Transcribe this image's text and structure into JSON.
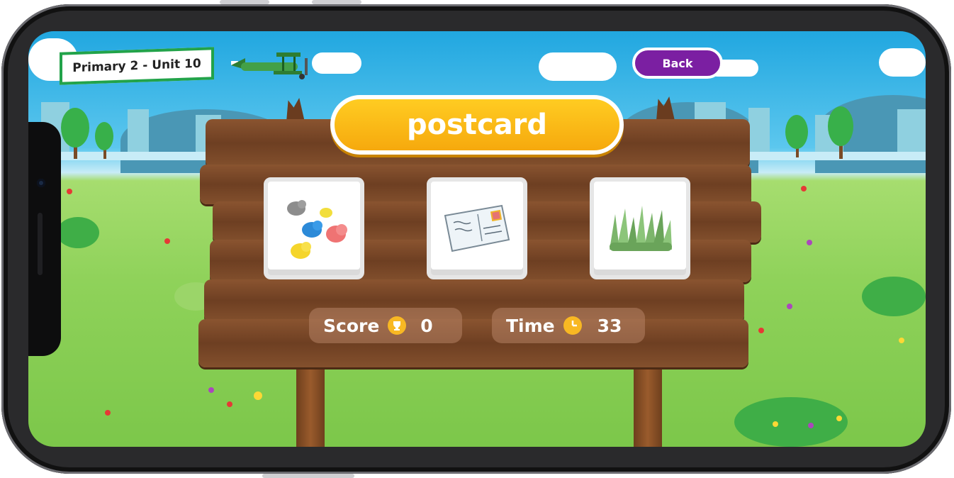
{
  "header": {
    "level_label": "Primary 2 - Unit 10",
    "back_label": "Back"
  },
  "game": {
    "target_word": "postcard",
    "choices": [
      {
        "name": "birds",
        "icon": "birds-picture"
      },
      {
        "name": "postcard",
        "icon": "postcard-picture"
      },
      {
        "name": "grass",
        "icon": "grass-picture"
      }
    ],
    "score_label": "Score",
    "score_value": "0",
    "time_label": "Time",
    "time_value": "33"
  },
  "colors": {
    "accent": "#f6a90d",
    "back_button": "#7b1fa2",
    "banner_border": "#22a34a"
  }
}
